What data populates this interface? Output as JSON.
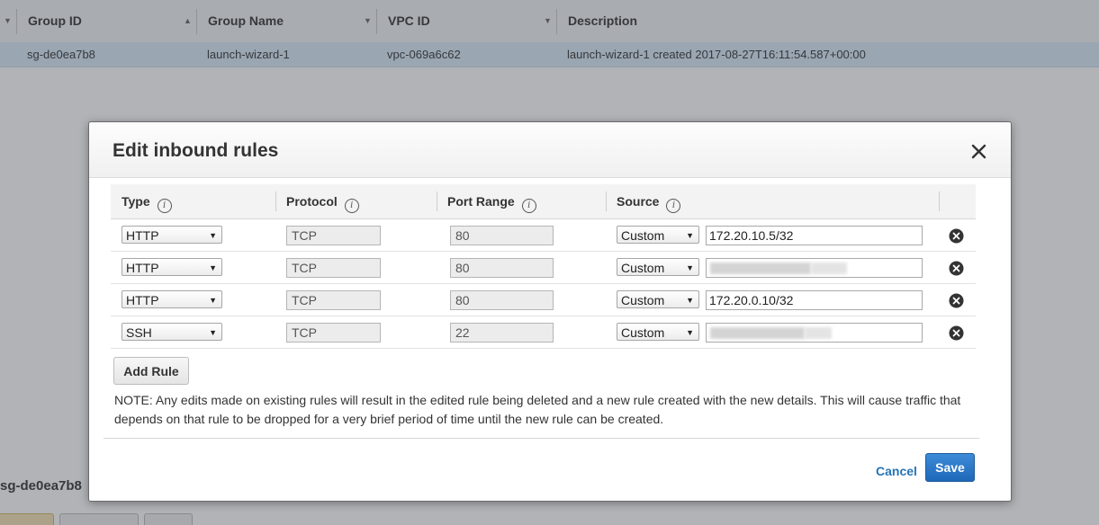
{
  "background": {
    "columns": [
      {
        "label": "Group ID"
      },
      {
        "label": "Group Name"
      },
      {
        "label": "VPC ID"
      },
      {
        "label": "Description"
      }
    ],
    "row": {
      "group_id": "sg-de0ea7b8",
      "group_name": "launch-wizard-1",
      "vpc_id": "vpc-069a6c62",
      "description": "launch-wizard-1 created 2017-08-27T16:11:54.587+00:00"
    },
    "detail_title": "sg-de0ea7b8"
  },
  "modal": {
    "title": "Edit inbound rules",
    "columns": {
      "type": "Type",
      "protocol": "Protocol",
      "port_range": "Port Range",
      "source": "Source"
    },
    "info_glyph": "i",
    "rules": [
      {
        "type": "HTTP",
        "protocol": "TCP",
        "port_range": "80",
        "source_type": "Custom",
        "source_value": "172.20.10.5/32",
        "redacted": false
      },
      {
        "type": "HTTP",
        "protocol": "TCP",
        "port_range": "80",
        "source_type": "Custom",
        "source_value": "",
        "redacted": true
      },
      {
        "type": "HTTP",
        "protocol": "TCP",
        "port_range": "80",
        "source_type": "Custom",
        "source_value": "172.20.0.10/32",
        "redacted": false
      },
      {
        "type": "SSH",
        "protocol": "TCP",
        "port_range": "22",
        "source_type": "Custom",
        "source_value": "",
        "redacted": true
      }
    ],
    "add_rule_label": "Add Rule",
    "note": "NOTE: Any edits made on existing rules will result in the edited rule being deleted and a new rule created with the new details. This will cause traffic that depends on that rule to be dropped for a very brief period of time until the new rule can be created.",
    "cancel_label": "Cancel",
    "save_label": "Save"
  },
  "colors": {
    "accent_link": "#2574b8",
    "primary_button": "#1e68b8",
    "selected_row": "#d9eaf7"
  },
  "icons": {
    "close": "close-icon",
    "remove": "remove-circle-icon",
    "info": "info-icon",
    "dropdown": "chevron-down-icon",
    "sort_up": "sort-up-icon",
    "sort_down": "sort-down-icon"
  }
}
